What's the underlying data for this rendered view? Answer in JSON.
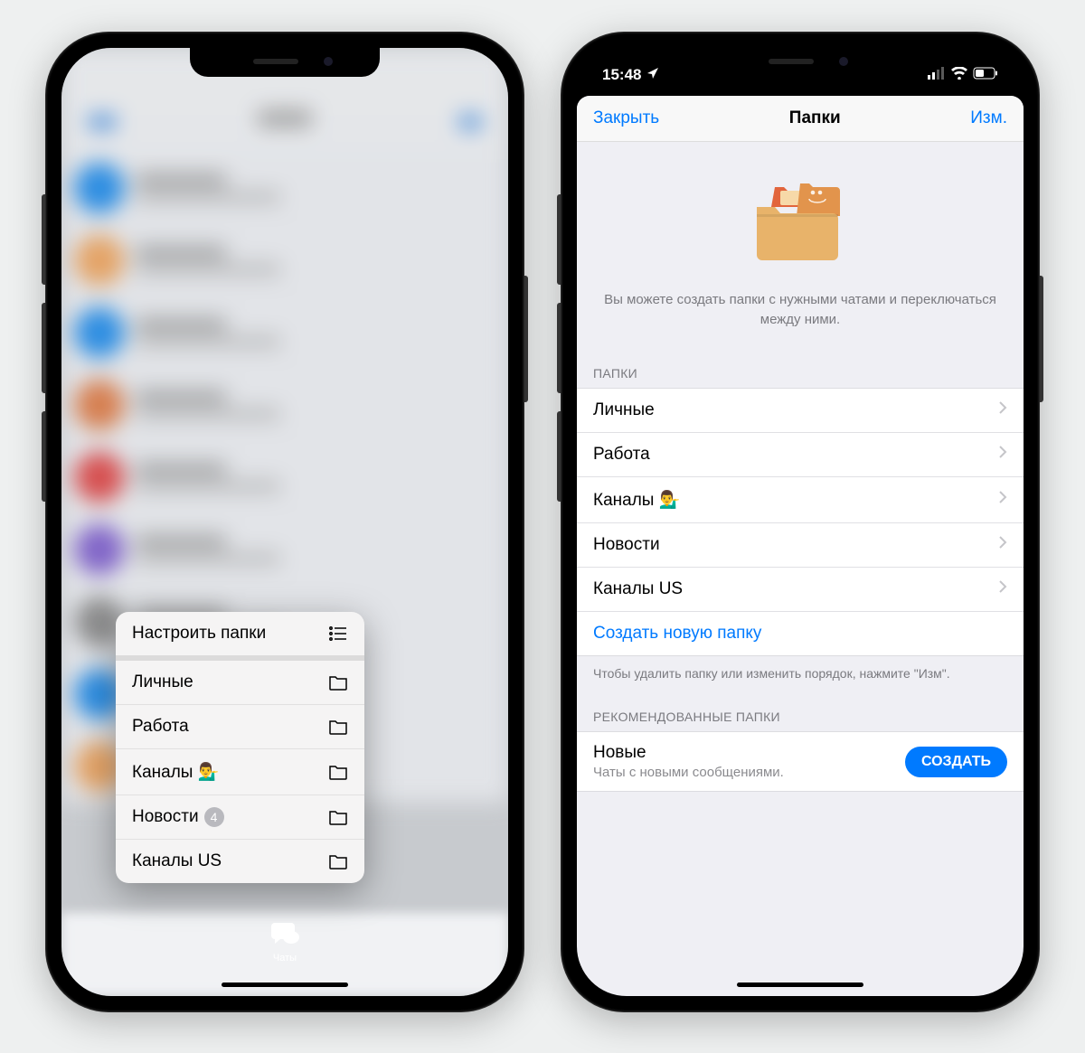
{
  "phone1": {
    "context_menu": {
      "configure": "Настроить папки",
      "items": [
        {
          "label": "Личные",
          "badge": null
        },
        {
          "label": "Работа",
          "badge": null
        },
        {
          "label": "Каналы 💁‍♂️",
          "badge": null
        },
        {
          "label": "Новости",
          "badge": "4"
        },
        {
          "label": "Каналы US",
          "badge": null
        }
      ]
    },
    "tab": {
      "chats": "Чаты"
    }
  },
  "phone2": {
    "status": {
      "time": "15:48"
    },
    "modal": {
      "close": "Закрыть",
      "title": "Папки",
      "edit": "Изм.",
      "hero_text": "Вы можете создать папки с нужными чатами и переключаться между ними.",
      "section_folders": "ПАПКИ",
      "folders": [
        "Личные",
        "Работа",
        "Каналы 💁‍♂️",
        "Новости",
        "Каналы US"
      ],
      "create_new": "Создать новую папку",
      "folders_footer": "Чтобы удалить папку или изменить порядок, нажмите \"Изм\".",
      "section_reco": "РЕКОМЕНДОВАННЫЕ ПАПКИ",
      "reco": {
        "title": "Новые",
        "sub": "Чаты с новыми сообщениями.",
        "button": "СОЗДАТЬ"
      }
    }
  }
}
